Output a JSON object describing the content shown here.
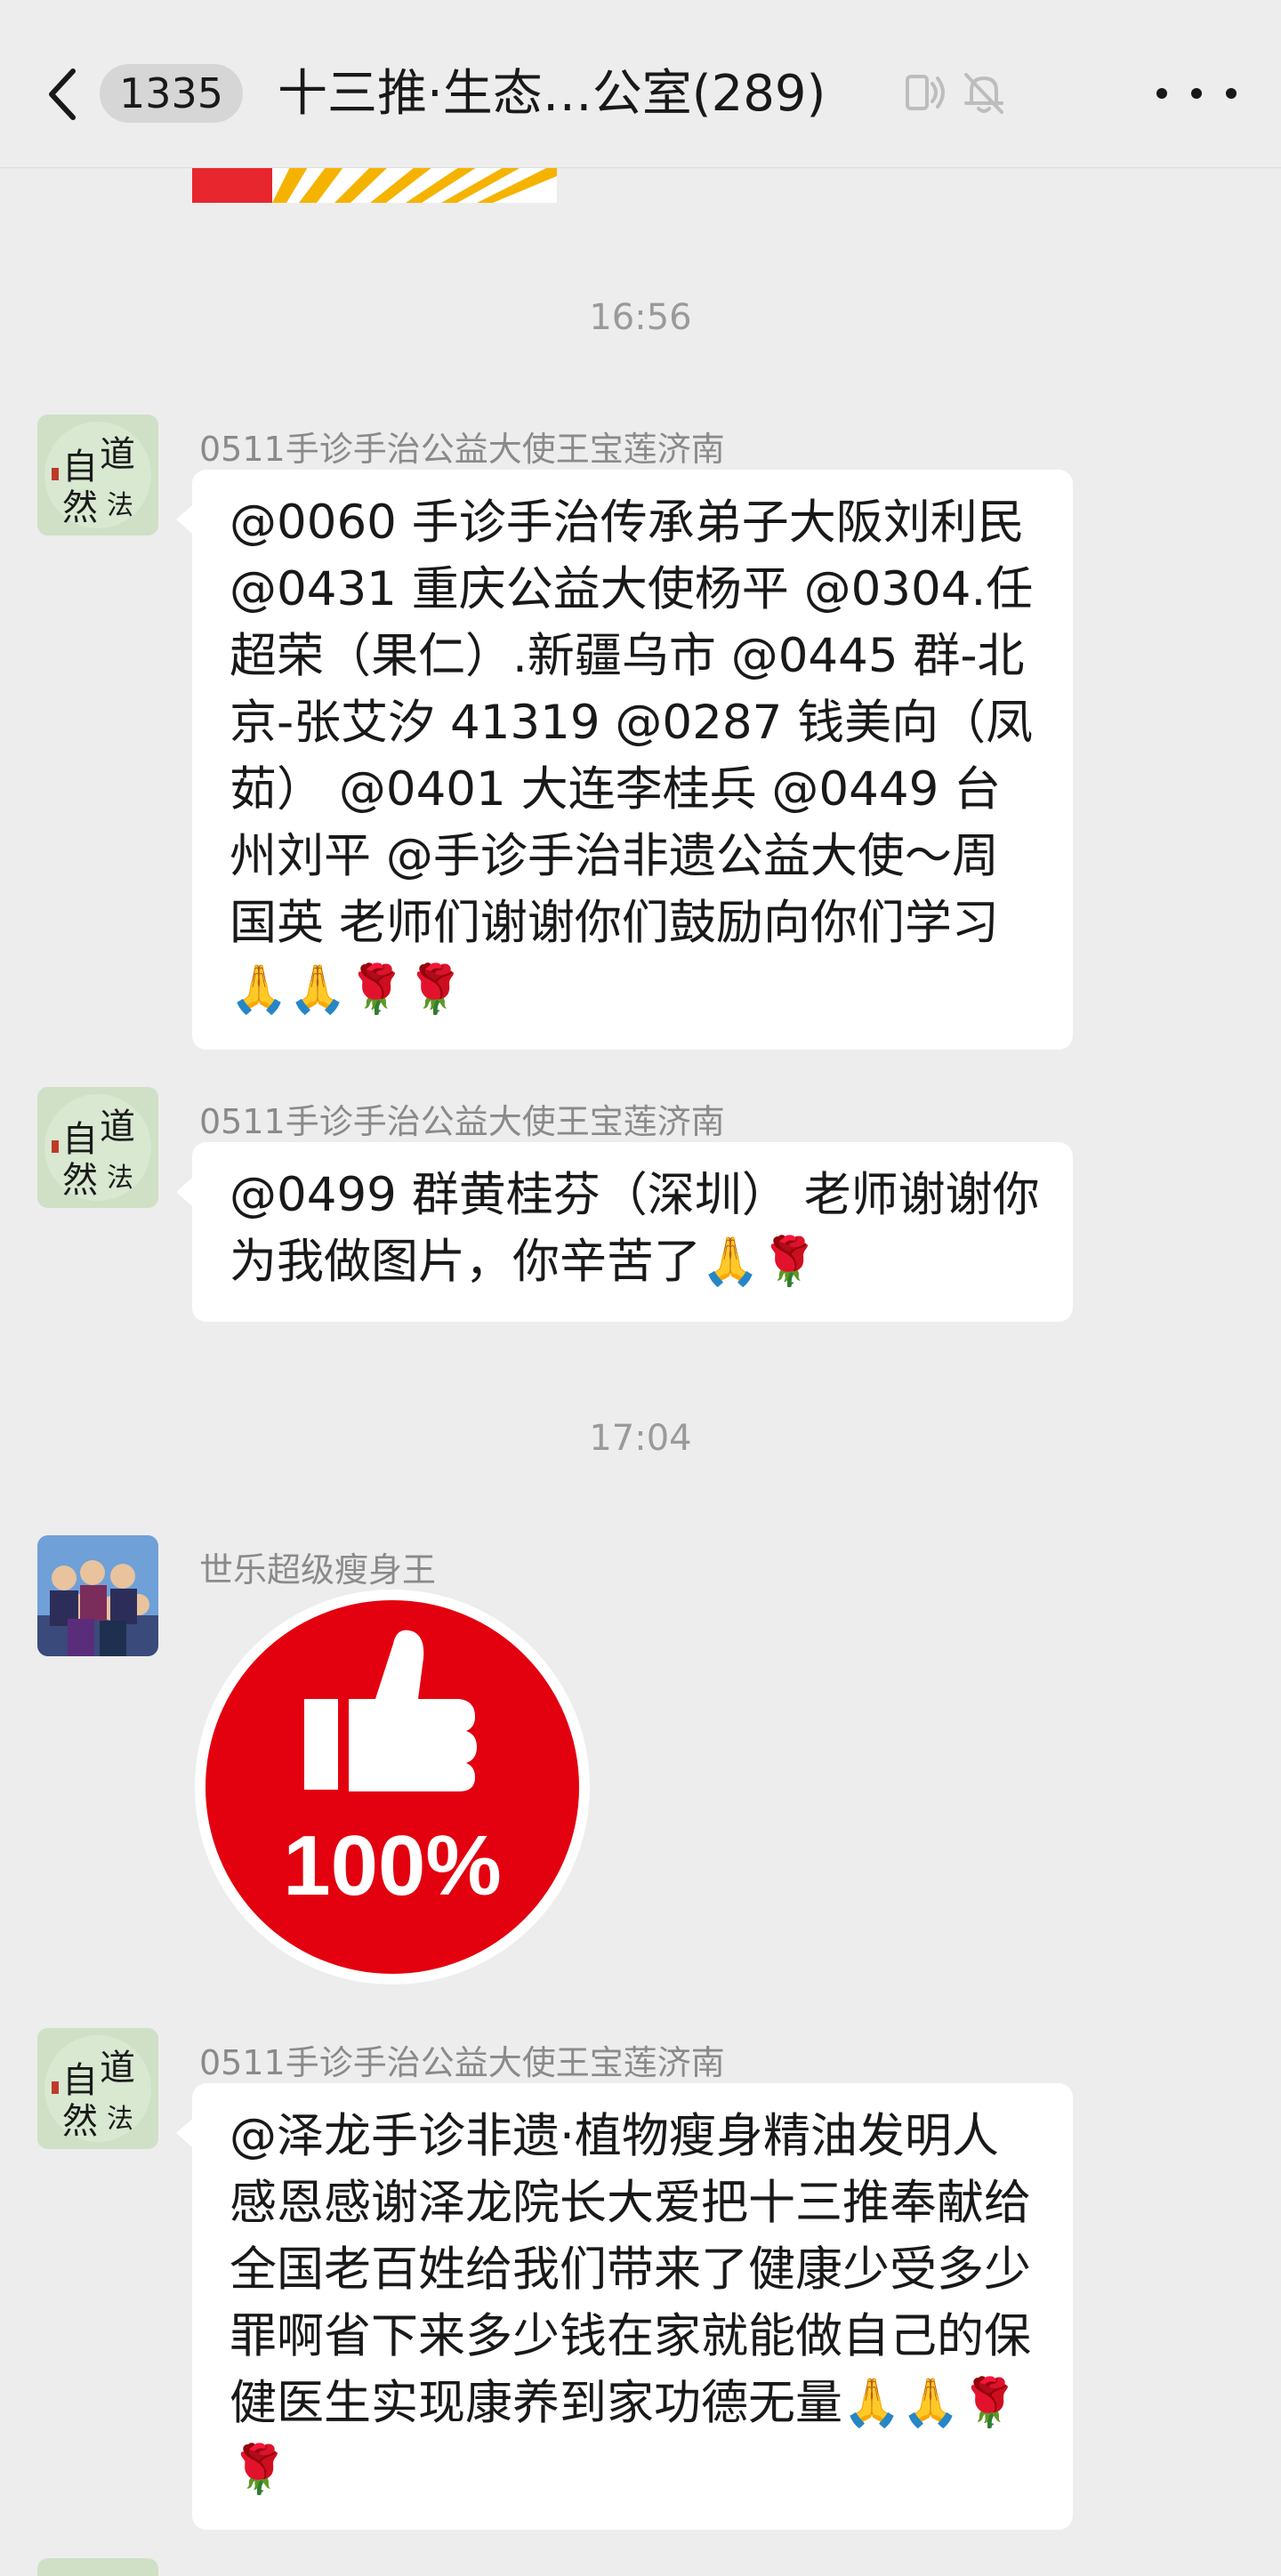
{
  "header": {
    "back_icon": "chevron-left-icon",
    "unread_count": "1335",
    "title": "十三推·生态…公室(289)",
    "voice_icon": "voice-input-icon",
    "mute_icon": "bell-muted-icon",
    "more_icon": "more-dots-icon"
  },
  "messages": [
    {
      "type": "timestamp",
      "text": "16:56"
    },
    {
      "type": "text",
      "sender": "0511手诊手治公益大使王宝莲济南",
      "text": "@0060 手诊手治传承弟子大阪刘利民 @0431 重庆公益大使杨平 @0304.任超荣（果仁）.新疆乌市 @0445 群-北京-张艾汐 41319 @0287 钱美向（凤茹） @0401 大连李桂兵 @0449 台州刘平 @手诊手治非遗公益大使～周国英 老师们谢谢你们鼓励向你们学习🙏🙏🌹🌹"
    },
    {
      "type": "text",
      "sender": "0511手诊手治公益大使王宝莲济南",
      "text": "@0499 群黄桂芬（深圳） 老师谢谢你为我做图片，你辛苦了🙏🌹"
    },
    {
      "type": "timestamp",
      "text": "17:04"
    },
    {
      "type": "sticker",
      "sender": "世乐超级瘦身王",
      "sticker_text": "100%",
      "sticker_icon": "thumbs-up-icon",
      "sticker_color": "#e3000f"
    },
    {
      "type": "text",
      "sender": "0511手诊手治公益大使王宝莲济南",
      "text": "@泽龙手诊非遗·植物瘦身精油发明人 感恩感谢泽龙院长大爱把十三推奉献给全国老百姓给我们带来了健康少受多少罪啊省下来多少钱在家就能做自己的保健医生实现康养到家功德无量🙏🙏🌹🌹"
    }
  ],
  "colors": {
    "background": "#ededed",
    "bubble": "#ffffff",
    "sender": "#8a8a8a",
    "timestamp": "#9a9a9a",
    "sticker_red": "#e3000f"
  }
}
